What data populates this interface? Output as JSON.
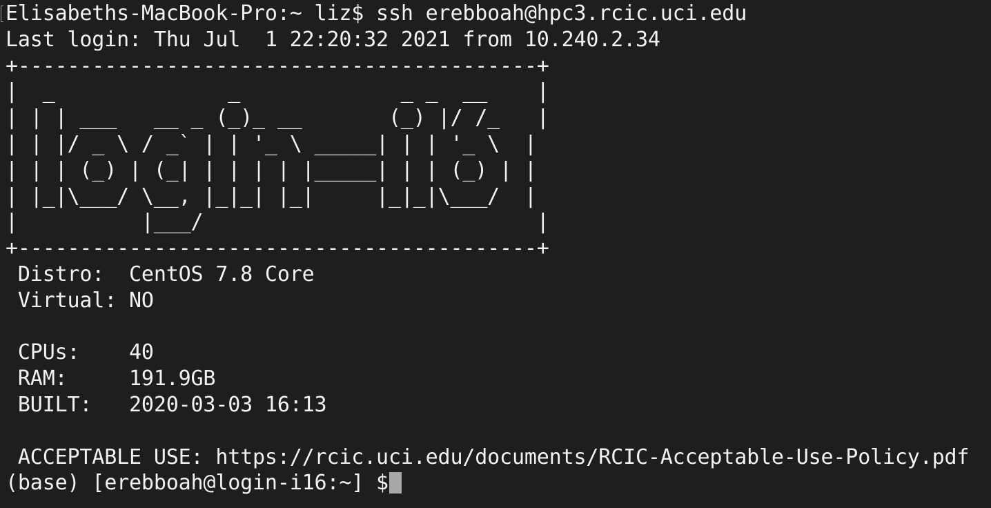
{
  "terminal": {
    "lines": [
      "Elisabeths-MacBook-Pro:~ liz$ ssh erebboah@hpc3.rcic.uci.edu",
      "Last login: Thu Jul  1 22:20:32 2021 from 10.240.2.34",
      "+------------------------------------------+",
      "|  _              _             _ _  __    |",
      "| | | ___   __ _ (_)_ __       (_) |/ /_   |",
      "| | |/ _ \\ / _` | | '_ \\ _____| | | '_ \\  |",
      "| | | (_) | (_| | | | | |_____| | | (_) | |",
      "| |_|\\___/ \\__, |_|_| |_|     |_|_|\\___/  |",
      "|          |___/                           |",
      "+------------------------------------------+",
      " Distro:  CentOS 7.8 Core",
      " Virtual: NO",
      "",
      " CPUs:    40",
      " RAM:     191.9GB",
      " BUILT:   2020-03-03 16:13",
      "",
      " ACCEPTABLE USE: https://rcic.uci.edu/documents/RCIC-Acceptable-Use-Policy.pdf"
    ],
    "prompt": "(base) [erebboah@login-i16:~] $"
  }
}
